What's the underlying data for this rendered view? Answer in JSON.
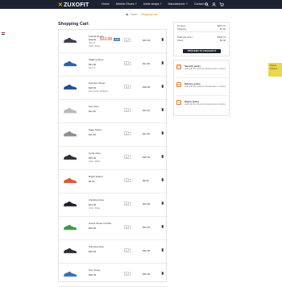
{
  "header": {
    "brand": "ZUXOFIT",
    "nav": [
      "Home",
      "Athletic Shoes ˅",
      "Ankle straps ˅",
      "Manufacturer ˅",
      "Contact us"
    ],
    "cart_count": "2"
  },
  "breadcrumb": {
    "home": "Home",
    "current": "Shopping Cart"
  },
  "page_title": "Shopping Cart",
  "cart_items": [
    {
      "name": "Casual Shoes",
      "old_price": "$33.75",
      "new_price": "$33.90",
      "discount": "-10%",
      "sub1": "Size: 8",
      "sub2": "Color: White",
      "qty": "1",
      "total": "$33.90",
      "color": "#3a3f4a"
    },
    {
      "name": "Walking Shoe",
      "price": "$21.60",
      "sub1": "Size: 8",
      "qty": "1",
      "total": "$21.60",
      "color": "#2d5fa8"
    },
    {
      "name": "Superior Shoes",
      "price": "$28.00",
      "sub1": "Dimension: 40x60cm",
      "qty": "1",
      "total": "$28.00",
      "color": "#1e4f8c"
    },
    {
      "name": "Sun shoe",
      "price": "$11.90",
      "qty": "1",
      "total": "$11.90",
      "color": "#b7b9bd"
    },
    {
      "name": "Sage Shoes",
      "price": "$11.90",
      "qty": "1",
      "total": "$11.90",
      "color": "#8c8f95"
    },
    {
      "name": "Cycle shoe",
      "price": "$35.00",
      "sub1": "Color: White",
      "qty": "1",
      "total": "$35.00",
      "color": "#2b2f38"
    },
    {
      "name": "Bright Sisters",
      "price": "$9.00",
      "qty": "1",
      "total": "$9.00",
      "color": "#e0552b"
    },
    {
      "name": "Climbing shoe",
      "price": "$13.00",
      "sub1": "Color: White",
      "qty": "1",
      "total": "$13.00",
      "color": "#1f2229"
    },
    {
      "name": "Grand Shoes Gt Max",
      "price": "$32.00",
      "qty": "1",
      "total": "$32.00",
      "color": "#3b9a4a"
    },
    {
      "name": "Climbing shoe",
      "price": "$32.00",
      "qty": "1",
      "total": "$32.00",
      "color": "#2a2d34"
    },
    {
      "name": "Sun shoes",
      "price": "$35.00",
      "qty": "1",
      "total": "$35.00",
      "color": "#3c6fb0"
    }
  ],
  "summary": {
    "items_label": "11 items",
    "items_value": "$327.74",
    "shipping_label": "Shipping",
    "shipping_value": "$7.00",
    "total_label": "Total (tax excl.)",
    "total_value": "$334.74",
    "taxes_label": "Taxes",
    "taxes_value": "$0.00",
    "checkout": "PROCEED TO CHECKOUT"
  },
  "policies": [
    {
      "title": "Security policy",
      "text": "(edit with the Customer Reassurance module)"
    },
    {
      "title": "Delivery policy",
      "text": "(edit with the Customer Reassurance module)"
    },
    {
      "title": "Return policy",
      "text": "(edit with the Customer Reassurance module)"
    }
  ],
  "side_tab": "Theme Options",
  "colors": {
    "dark": "#1d2231",
    "accent": "#e67e22"
  }
}
